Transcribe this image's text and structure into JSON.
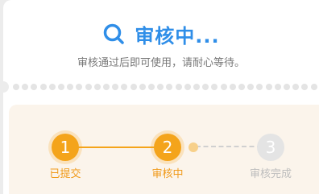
{
  "header": {
    "title": "审核中...",
    "icon": "search-icon",
    "accent_color": "#2f8ee8"
  },
  "message": "审核通过后即可使用，请耐心等待。",
  "steps": [
    {
      "number": "1",
      "label": "已提交",
      "status": "done"
    },
    {
      "number": "2",
      "label": "审核中",
      "status": "current"
    },
    {
      "number": "3",
      "label": "审核完成",
      "status": "pending"
    }
  ],
  "colors": {
    "step_active": "#f4a41b",
    "step_inactive": "#e4e4e4",
    "panel_bg": "#fbf4eb"
  }
}
